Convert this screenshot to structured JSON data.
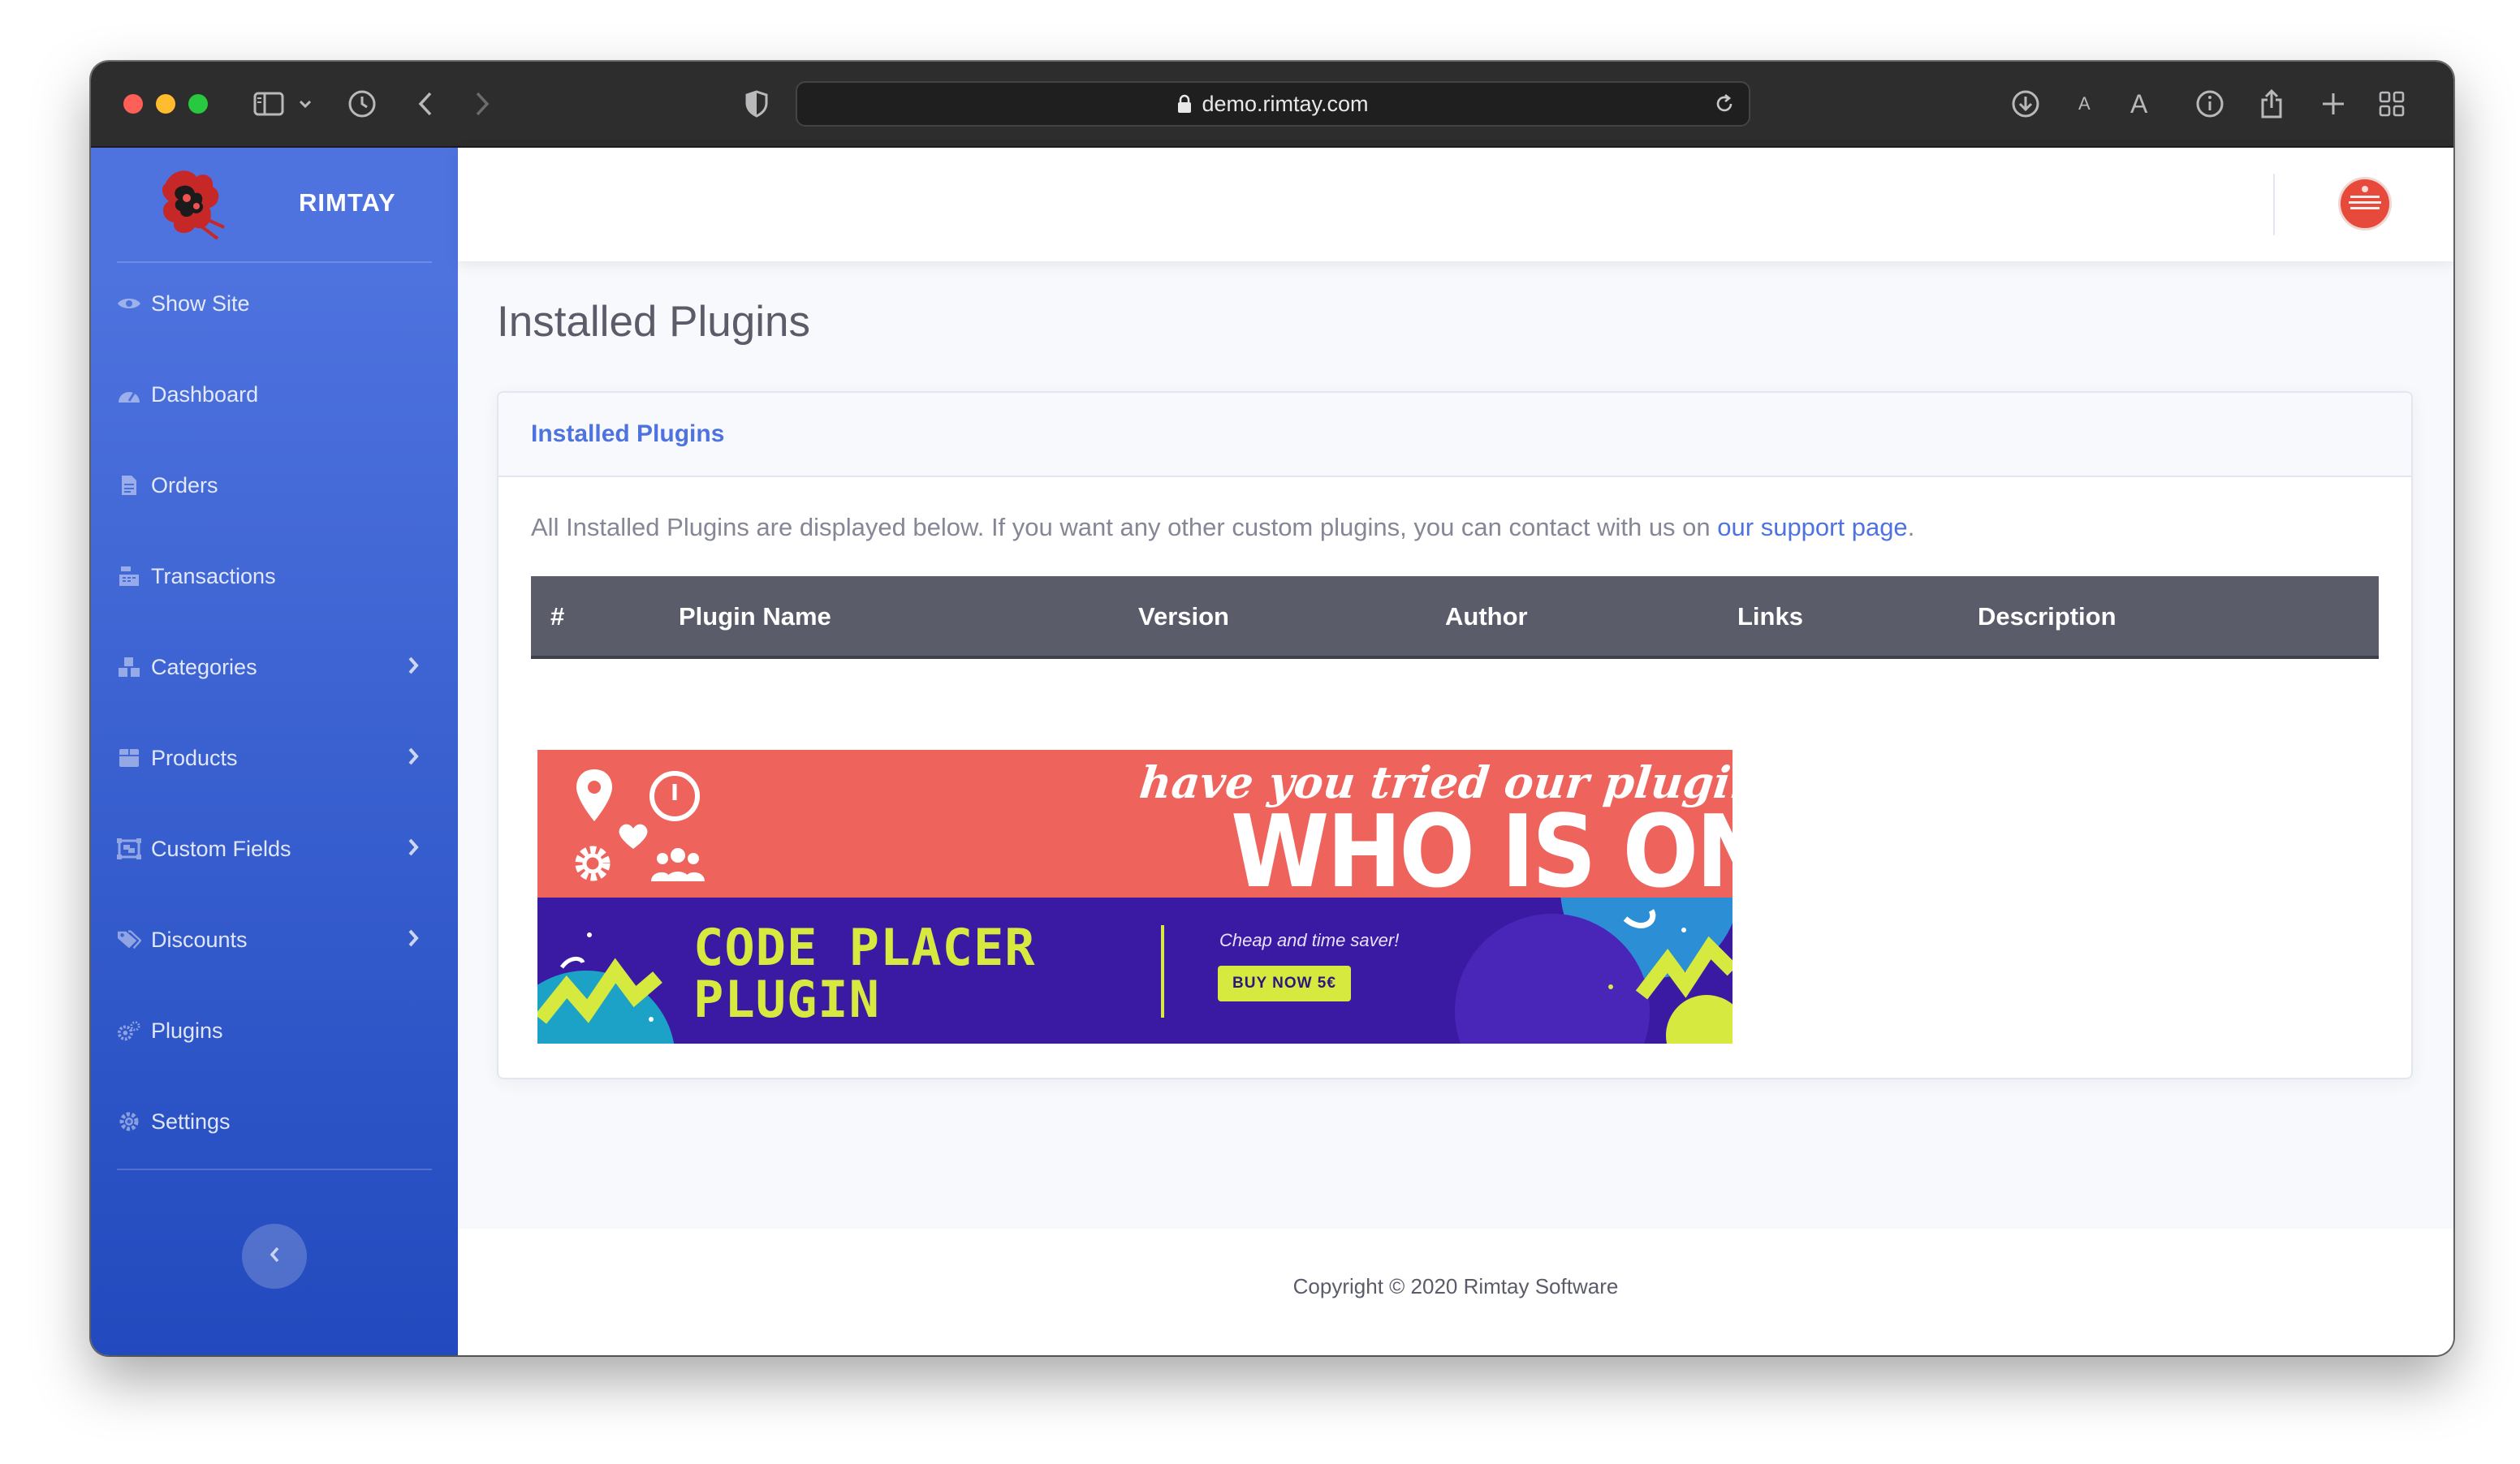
{
  "browser": {
    "url": "demo.rimtay.com"
  },
  "brand": {
    "name": "RIMTAY"
  },
  "sidebar": {
    "items": [
      {
        "label": "Show Site",
        "icon": "eye-icon",
        "has_submenu": false
      },
      {
        "label": "Dashboard",
        "icon": "tachometer-icon",
        "has_submenu": false
      },
      {
        "label": "Orders",
        "icon": "file-icon",
        "has_submenu": false
      },
      {
        "label": "Transactions",
        "icon": "cash-register-icon",
        "has_submenu": false
      },
      {
        "label": "Categories",
        "icon": "cubes-icon",
        "has_submenu": true
      },
      {
        "label": "Products",
        "icon": "box-icon",
        "has_submenu": true
      },
      {
        "label": "Custom Fields",
        "icon": "object-group-icon",
        "has_submenu": true
      },
      {
        "label": "Discounts",
        "icon": "tags-icon",
        "has_submenu": true
      },
      {
        "label": "Plugins",
        "icon": "cogs-icon",
        "has_submenu": false
      },
      {
        "label": "Settings",
        "icon": "cog-icon",
        "has_submenu": false
      }
    ]
  },
  "page": {
    "title": "Installed Plugins"
  },
  "card": {
    "header": "Installed Plugins",
    "intro_text": "All Installed Plugins are displayed below. If you want any other custom plugins, you can contact with us on ",
    "intro_link": "our support page",
    "intro_end": "."
  },
  "table": {
    "columns": [
      "#",
      "Plugin Name",
      "Version",
      "Author",
      "Links",
      "Description"
    ]
  },
  "promo": {
    "tagline": "have you tried our plugin?",
    "title": "WHO IS ONLINE",
    "product_title": "CODE PLACER\nPLUGIN",
    "product_tagline": "Cheap and time saver!",
    "buy_label": "BUY NOW 5€"
  },
  "footer": {
    "copyright": "Copyright © 2020 Rimtay Software"
  },
  "colors": {
    "primary": "#4e73df",
    "sidebar_gradient_end": "#224abe",
    "table_header": "#5a5c69",
    "promo_red": "#ee645d",
    "promo_purple": "#3b1aa3",
    "promo_lime": "#d6e93f"
  }
}
